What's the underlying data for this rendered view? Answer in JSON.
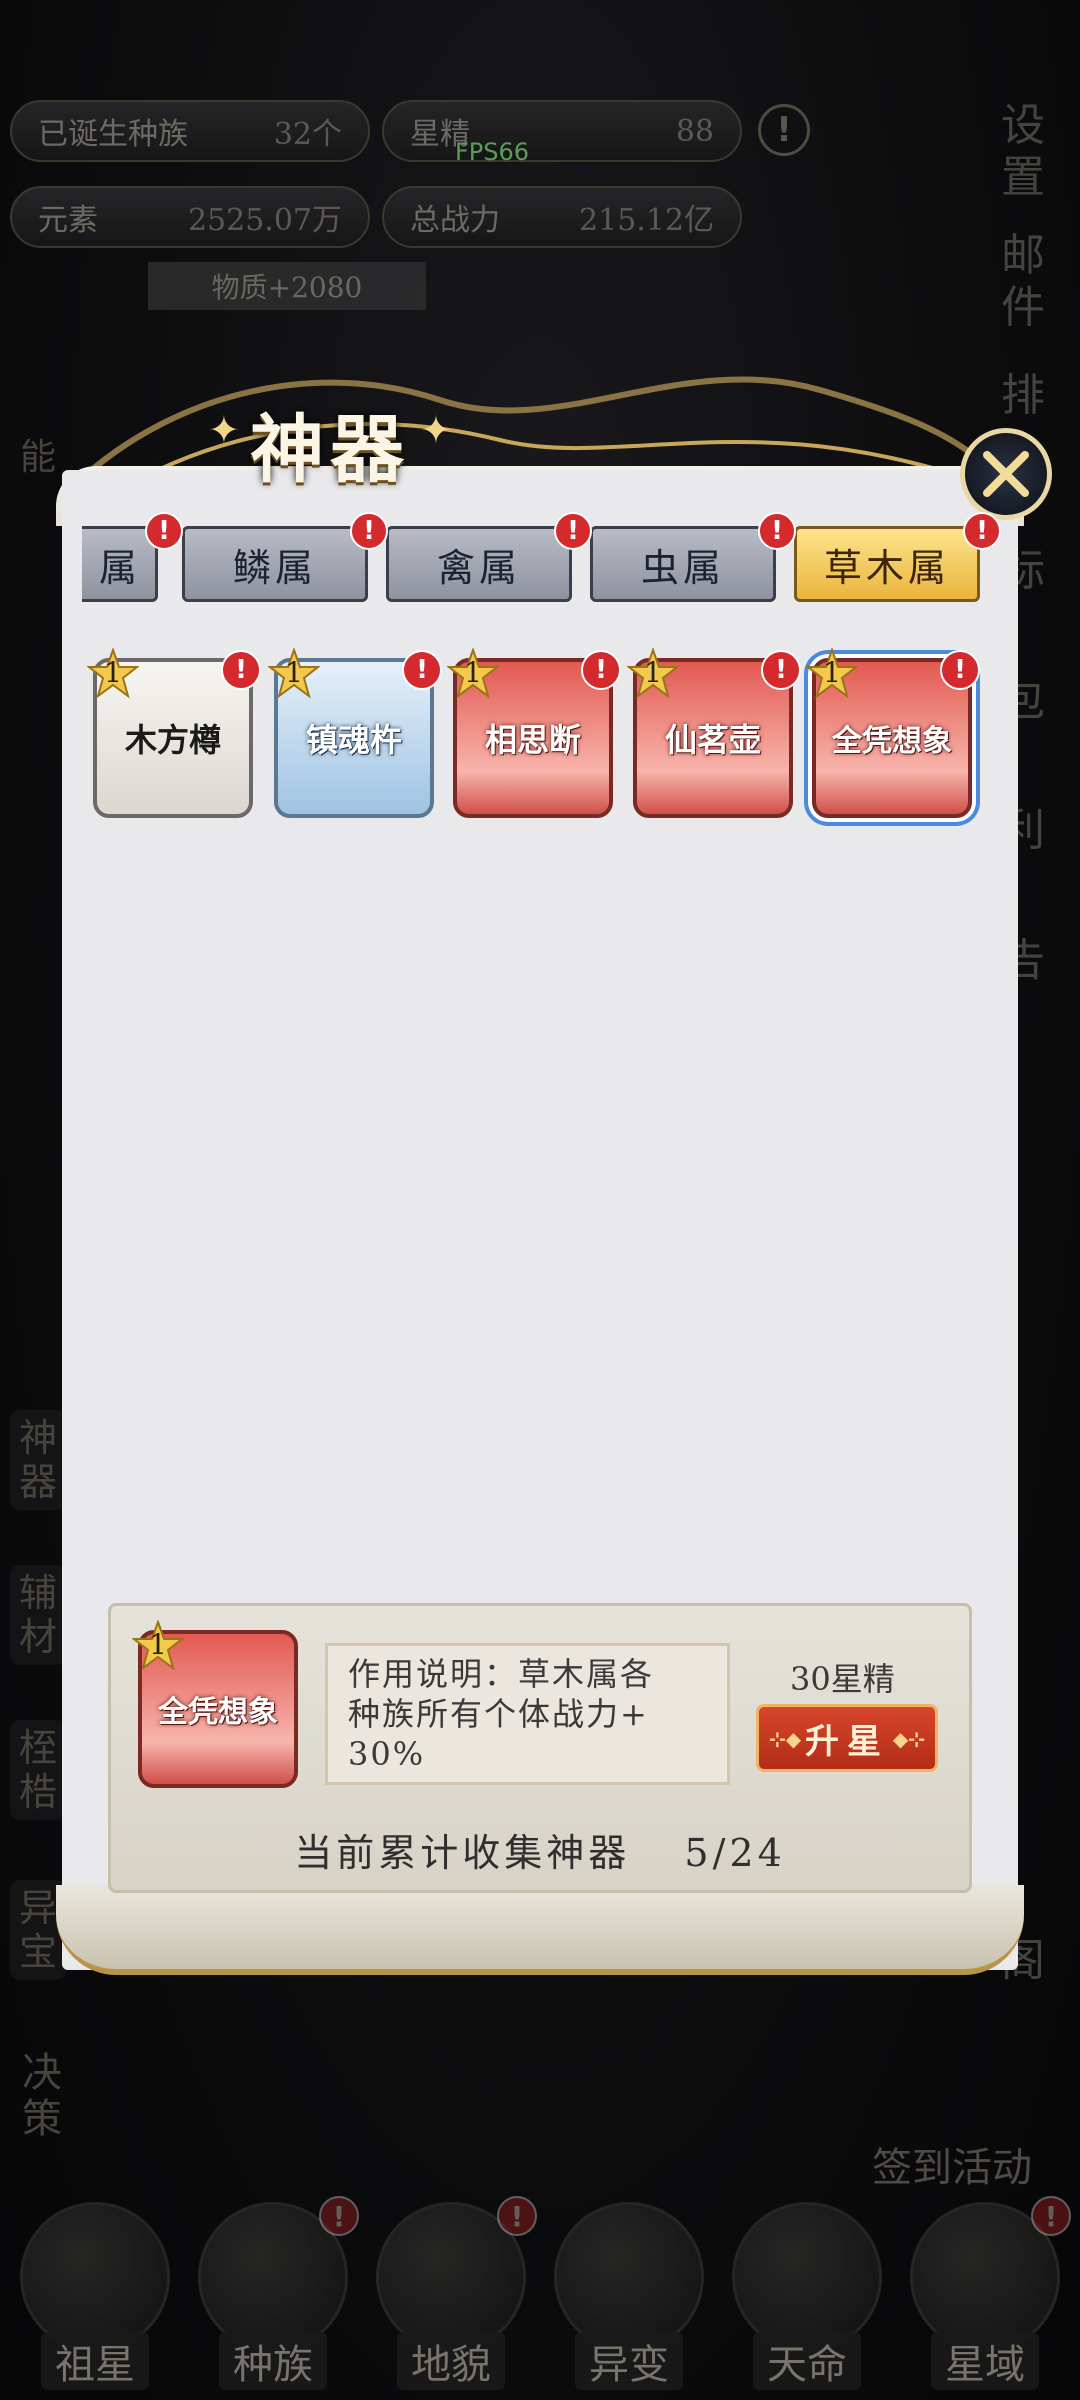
{
  "hud": {
    "races_label": "已诞生种族",
    "races_value": "32个",
    "star_essence_label": "星精",
    "star_essence_value": "88",
    "fps": "FPS66",
    "elements_label": "元素",
    "elements_value": "2525.07万",
    "power_label": "总战力",
    "power_value": "215.12亿",
    "matter": "物质+2080"
  },
  "side_right": {
    "settings": "设置",
    "mail": "邮件",
    "rank": "排",
    "mark": "标",
    "bag": "包",
    "benefit": "利",
    "notice": "告",
    "pavilion": "阁"
  },
  "side_left": {
    "artifact": "神器",
    "auxiliary": "辅材",
    "shackles": "桎梏",
    "treasure": "异宝",
    "decision": "决策",
    "top_label": "能"
  },
  "signin": "签到活动",
  "bottom_nav": [
    {
      "label": "祖星"
    },
    {
      "label": "种族"
    },
    {
      "label": "地貌"
    },
    {
      "label": "异变"
    },
    {
      "label": "天命"
    },
    {
      "label": "星域"
    }
  ],
  "modal": {
    "title": "神器",
    "tabs": [
      "属",
      "鳞属",
      "禽属",
      "虫属",
      "草木属"
    ],
    "active_tab": "草木属",
    "cards": [
      {
        "name": "木方樽",
        "stars": "1",
        "style": "white"
      },
      {
        "name": "镇魂杵",
        "stars": "1",
        "style": "blue"
      },
      {
        "name": "相思断",
        "stars": "1",
        "style": "red"
      },
      {
        "name": "仙茗壶",
        "stars": "1",
        "style": "red"
      },
      {
        "name": "全凭想象",
        "stars": "1",
        "style": "red"
      }
    ],
    "detail": {
      "name": "全凭想象",
      "stars": "1",
      "desc_line1": "作用说明：草木属各",
      "desc_line2": "种族所有个体战力+",
      "desc_line3": "30%",
      "cost": "30星精",
      "upgrade_label": "升星",
      "collect_label": "当前累计收集神器",
      "collect_value": "5/24"
    },
    "alert_mark": "!"
  },
  "colors": {
    "active_tab": "#eab540",
    "card_red": "#e25a52",
    "card_blue": "#9fc3e3",
    "upgrade_button": "#c23a22",
    "alert_red": "#d42a2e"
  }
}
